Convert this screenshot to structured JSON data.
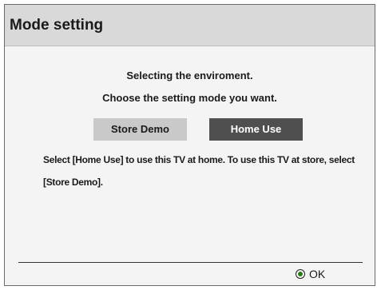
{
  "dialog": {
    "title": "Mode setting",
    "line1": "Selecting the enviroment.",
    "line2": "Choose the setting mode you want.",
    "buttons": {
      "store_demo": "Store Demo",
      "home_use": "Home Use"
    },
    "description": "Select [Home Use] to use this TV at home. To use this TV at store, select [Store Demo].",
    "footer": {
      "ok_icon": "ok-button-icon",
      "ok_label": "OK"
    }
  },
  "colors": {
    "title_bar": "#d9d9d9",
    "selected_button": "#4f4f4f",
    "unselected_button": "#c9c9c9",
    "ok_icon_accent": "#2a7a1a"
  }
}
